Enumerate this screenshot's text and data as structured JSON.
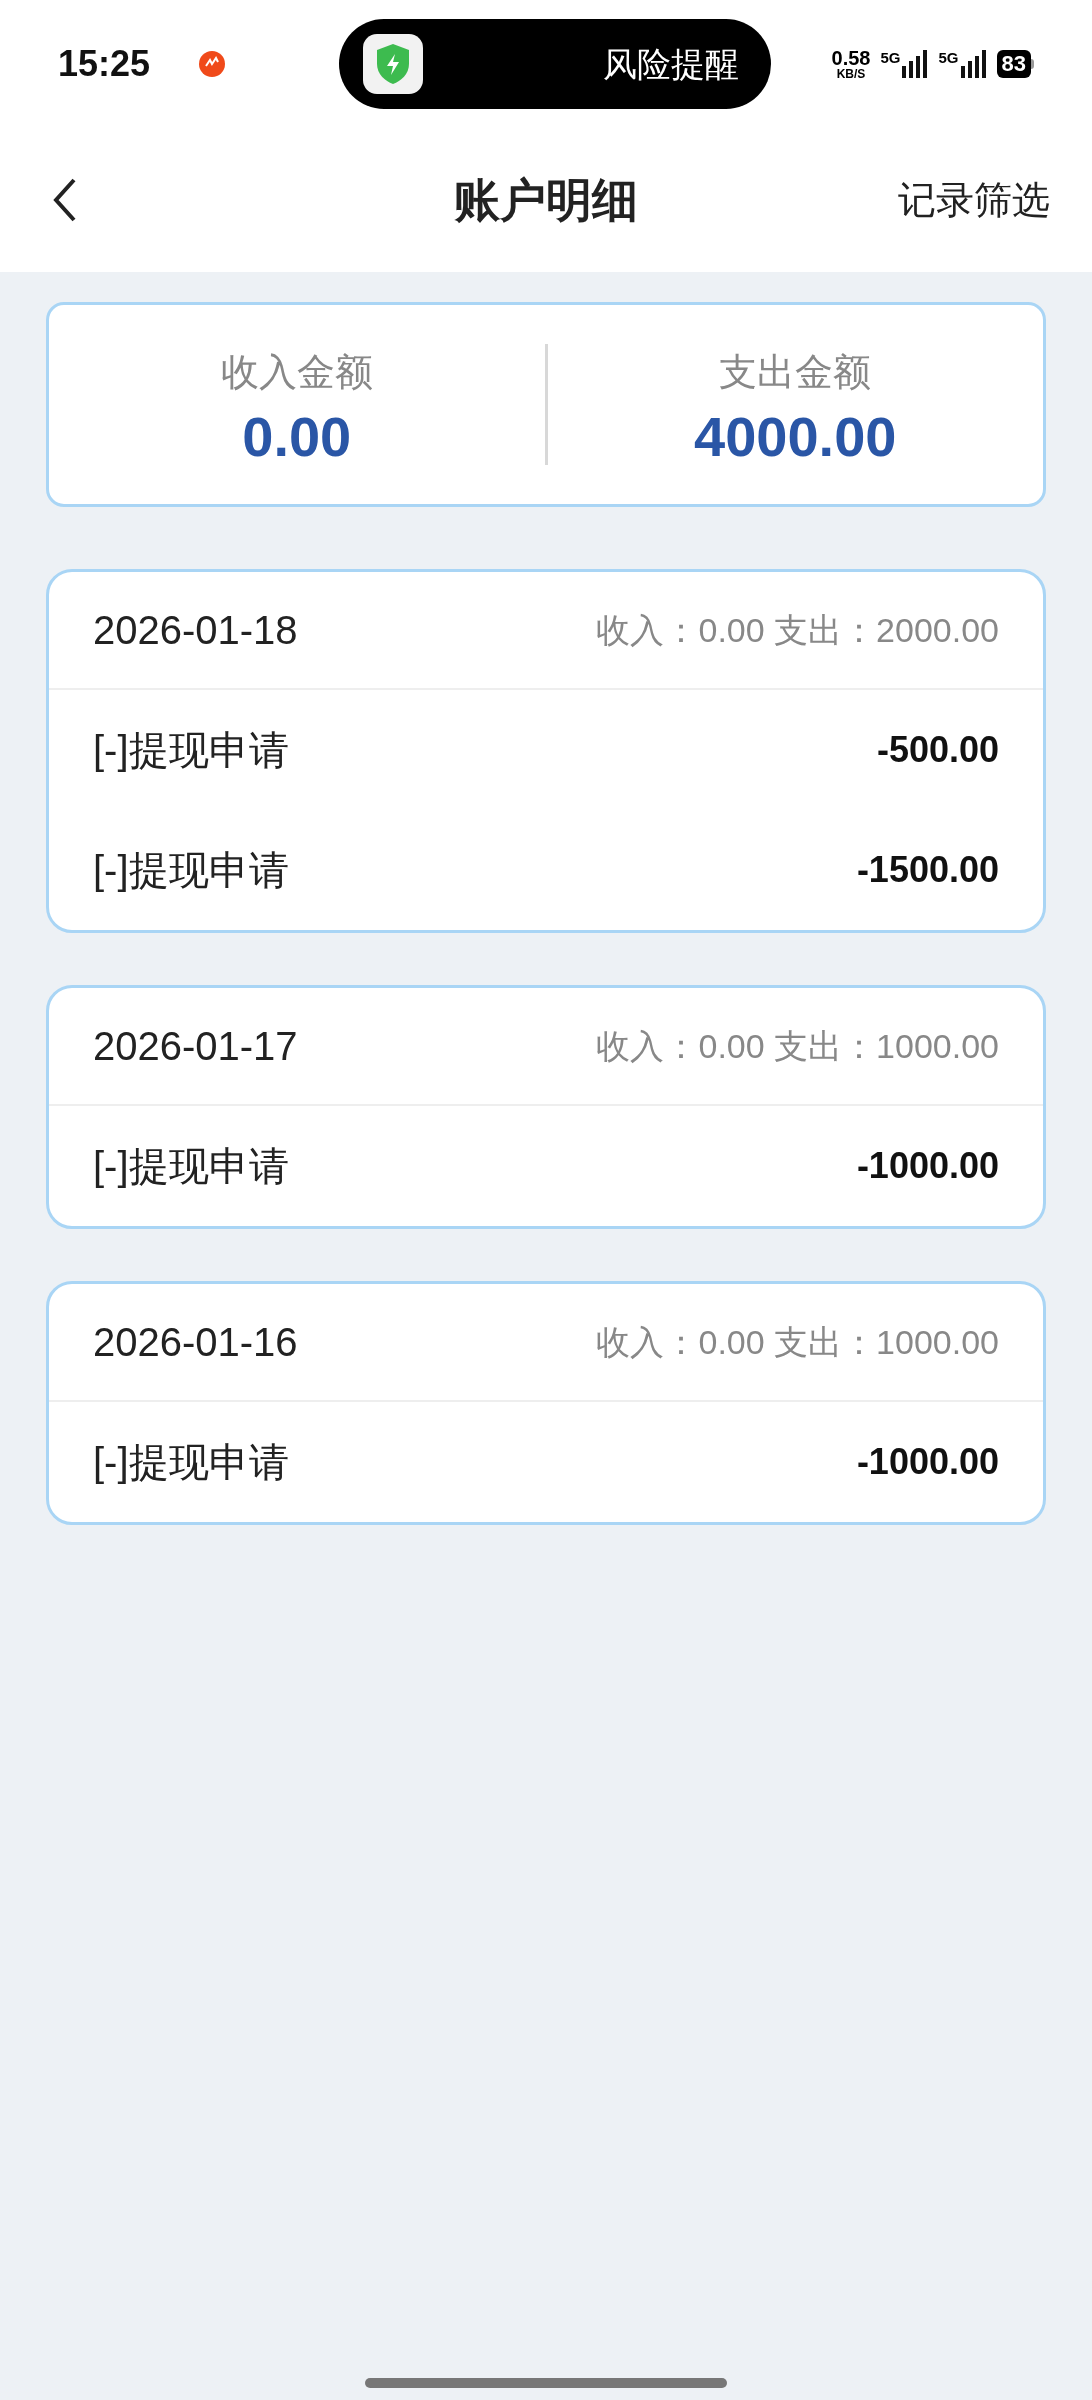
{
  "status_bar": {
    "time": "15:25",
    "island_text": "风险提醒",
    "speed": "0.58",
    "speed_unit": "KB/S",
    "network_1": "5G",
    "network_2": "5G",
    "battery": "83"
  },
  "header": {
    "title": "账户明细",
    "action": "记录筛选"
  },
  "summary": [
    {
      "label": "收入金额",
      "value": "0.00"
    },
    {
      "label": "支出金额",
      "value": "4000.00"
    }
  ],
  "days": [
    {
      "date": "2026-01-18",
      "totals": "收入：0.00 支出：2000.00",
      "items": [
        {
          "label": "[-]提现申请",
          "amount": "-500.00"
        },
        {
          "label": "[-]提现申请",
          "amount": "-1500.00"
        }
      ]
    },
    {
      "date": "2026-01-17",
      "totals": "收入：0.00 支出：1000.00",
      "items": [
        {
          "label": "[-]提现申请",
          "amount": "-1000.00"
        }
      ]
    },
    {
      "date": "2026-01-16",
      "totals": "收入：0.00 支出：1000.00",
      "items": [
        {
          "label": "[-]提现申请",
          "amount": "-1000.00"
        }
      ]
    }
  ]
}
